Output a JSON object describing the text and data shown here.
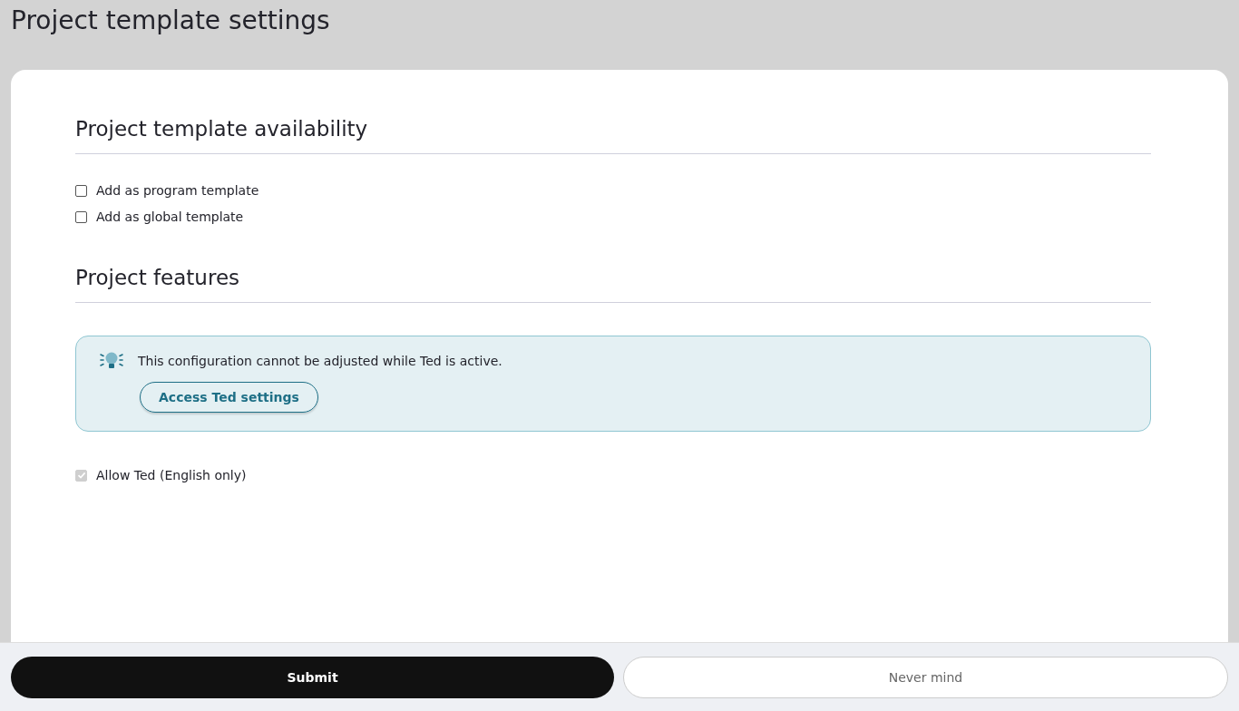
{
  "page_title": "Project template settings",
  "sections": [
    {
      "heading": "Project template availability",
      "kind": "checkboxes",
      "options": [
        {
          "label": "Add as program template",
          "checked": false,
          "disabled": false
        },
        {
          "label": "Add as global template",
          "checked": false,
          "disabled": false
        }
      ]
    },
    {
      "heading": "Project features",
      "kind": "notice",
      "notice": {
        "message": "This configuration cannot be adjusted while Ted is active.",
        "button": "Access Ted settings"
      },
      "options": [
        {
          "label": "Allow Ted (English only)",
          "checked": true,
          "disabled": true
        }
      ]
    }
  ],
  "footer": {
    "submit": "Submit",
    "cancel": "Never mind"
  }
}
